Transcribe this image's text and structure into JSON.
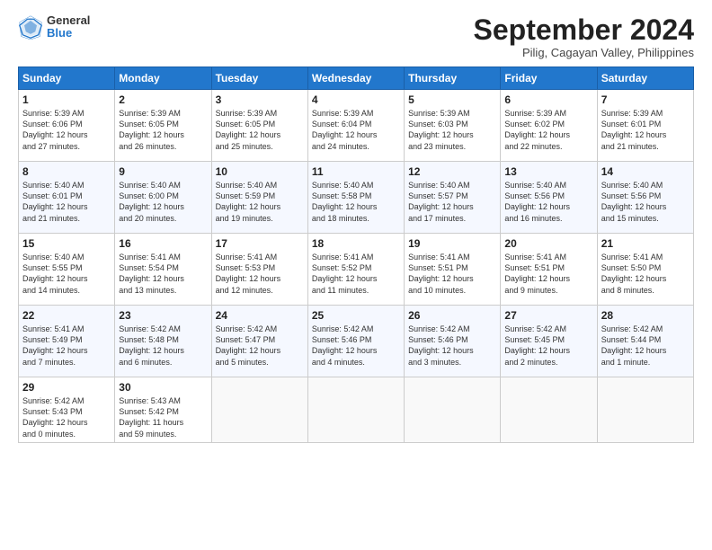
{
  "header": {
    "logo_general": "General",
    "logo_blue": "Blue",
    "month_title": "September 2024",
    "subtitle": "Pilig, Cagayan Valley, Philippines"
  },
  "weekdays": [
    "Sunday",
    "Monday",
    "Tuesday",
    "Wednesday",
    "Thursday",
    "Friday",
    "Saturday"
  ],
  "weeks": [
    [
      {
        "day": "1",
        "lines": [
          "Sunrise: 5:39 AM",
          "Sunset: 6:06 PM",
          "Daylight: 12 hours",
          "and 27 minutes."
        ]
      },
      {
        "day": "2",
        "lines": [
          "Sunrise: 5:39 AM",
          "Sunset: 6:05 PM",
          "Daylight: 12 hours",
          "and 26 minutes."
        ]
      },
      {
        "day": "3",
        "lines": [
          "Sunrise: 5:39 AM",
          "Sunset: 6:05 PM",
          "Daylight: 12 hours",
          "and 25 minutes."
        ]
      },
      {
        "day": "4",
        "lines": [
          "Sunrise: 5:39 AM",
          "Sunset: 6:04 PM",
          "Daylight: 12 hours",
          "and 24 minutes."
        ]
      },
      {
        "day": "5",
        "lines": [
          "Sunrise: 5:39 AM",
          "Sunset: 6:03 PM",
          "Daylight: 12 hours",
          "and 23 minutes."
        ]
      },
      {
        "day": "6",
        "lines": [
          "Sunrise: 5:39 AM",
          "Sunset: 6:02 PM",
          "Daylight: 12 hours",
          "and 22 minutes."
        ]
      },
      {
        "day": "7",
        "lines": [
          "Sunrise: 5:39 AM",
          "Sunset: 6:01 PM",
          "Daylight: 12 hours",
          "and 21 minutes."
        ]
      }
    ],
    [
      {
        "day": "8",
        "lines": [
          "Sunrise: 5:40 AM",
          "Sunset: 6:01 PM",
          "Daylight: 12 hours",
          "and 21 minutes."
        ]
      },
      {
        "day": "9",
        "lines": [
          "Sunrise: 5:40 AM",
          "Sunset: 6:00 PM",
          "Daylight: 12 hours",
          "and 20 minutes."
        ]
      },
      {
        "day": "10",
        "lines": [
          "Sunrise: 5:40 AM",
          "Sunset: 5:59 PM",
          "Daylight: 12 hours",
          "and 19 minutes."
        ]
      },
      {
        "day": "11",
        "lines": [
          "Sunrise: 5:40 AM",
          "Sunset: 5:58 PM",
          "Daylight: 12 hours",
          "and 18 minutes."
        ]
      },
      {
        "day": "12",
        "lines": [
          "Sunrise: 5:40 AM",
          "Sunset: 5:57 PM",
          "Daylight: 12 hours",
          "and 17 minutes."
        ]
      },
      {
        "day": "13",
        "lines": [
          "Sunrise: 5:40 AM",
          "Sunset: 5:56 PM",
          "Daylight: 12 hours",
          "and 16 minutes."
        ]
      },
      {
        "day": "14",
        "lines": [
          "Sunrise: 5:40 AM",
          "Sunset: 5:56 PM",
          "Daylight: 12 hours",
          "and 15 minutes."
        ]
      }
    ],
    [
      {
        "day": "15",
        "lines": [
          "Sunrise: 5:40 AM",
          "Sunset: 5:55 PM",
          "Daylight: 12 hours",
          "and 14 minutes."
        ]
      },
      {
        "day": "16",
        "lines": [
          "Sunrise: 5:41 AM",
          "Sunset: 5:54 PM",
          "Daylight: 12 hours",
          "and 13 minutes."
        ]
      },
      {
        "day": "17",
        "lines": [
          "Sunrise: 5:41 AM",
          "Sunset: 5:53 PM",
          "Daylight: 12 hours",
          "and 12 minutes."
        ]
      },
      {
        "day": "18",
        "lines": [
          "Sunrise: 5:41 AM",
          "Sunset: 5:52 PM",
          "Daylight: 12 hours",
          "and 11 minutes."
        ]
      },
      {
        "day": "19",
        "lines": [
          "Sunrise: 5:41 AM",
          "Sunset: 5:51 PM",
          "Daylight: 12 hours",
          "and 10 minutes."
        ]
      },
      {
        "day": "20",
        "lines": [
          "Sunrise: 5:41 AM",
          "Sunset: 5:51 PM",
          "Daylight: 12 hours",
          "and 9 minutes."
        ]
      },
      {
        "day": "21",
        "lines": [
          "Sunrise: 5:41 AM",
          "Sunset: 5:50 PM",
          "Daylight: 12 hours",
          "and 8 minutes."
        ]
      }
    ],
    [
      {
        "day": "22",
        "lines": [
          "Sunrise: 5:41 AM",
          "Sunset: 5:49 PM",
          "Daylight: 12 hours",
          "and 7 minutes."
        ]
      },
      {
        "day": "23",
        "lines": [
          "Sunrise: 5:42 AM",
          "Sunset: 5:48 PM",
          "Daylight: 12 hours",
          "and 6 minutes."
        ]
      },
      {
        "day": "24",
        "lines": [
          "Sunrise: 5:42 AM",
          "Sunset: 5:47 PM",
          "Daylight: 12 hours",
          "and 5 minutes."
        ]
      },
      {
        "day": "25",
        "lines": [
          "Sunrise: 5:42 AM",
          "Sunset: 5:46 PM",
          "Daylight: 12 hours",
          "and 4 minutes."
        ]
      },
      {
        "day": "26",
        "lines": [
          "Sunrise: 5:42 AM",
          "Sunset: 5:46 PM",
          "Daylight: 12 hours",
          "and 3 minutes."
        ]
      },
      {
        "day": "27",
        "lines": [
          "Sunrise: 5:42 AM",
          "Sunset: 5:45 PM",
          "Daylight: 12 hours",
          "and 2 minutes."
        ]
      },
      {
        "day": "28",
        "lines": [
          "Sunrise: 5:42 AM",
          "Sunset: 5:44 PM",
          "Daylight: 12 hours",
          "and 1 minute."
        ]
      }
    ],
    [
      {
        "day": "29",
        "lines": [
          "Sunrise: 5:42 AM",
          "Sunset: 5:43 PM",
          "Daylight: 12 hours",
          "and 0 minutes."
        ]
      },
      {
        "day": "30",
        "lines": [
          "Sunrise: 5:43 AM",
          "Sunset: 5:42 PM",
          "Daylight: 11 hours",
          "and 59 minutes."
        ]
      },
      {
        "day": "",
        "lines": []
      },
      {
        "day": "",
        "lines": []
      },
      {
        "day": "",
        "lines": []
      },
      {
        "day": "",
        "lines": []
      },
      {
        "day": "",
        "lines": []
      }
    ]
  ]
}
